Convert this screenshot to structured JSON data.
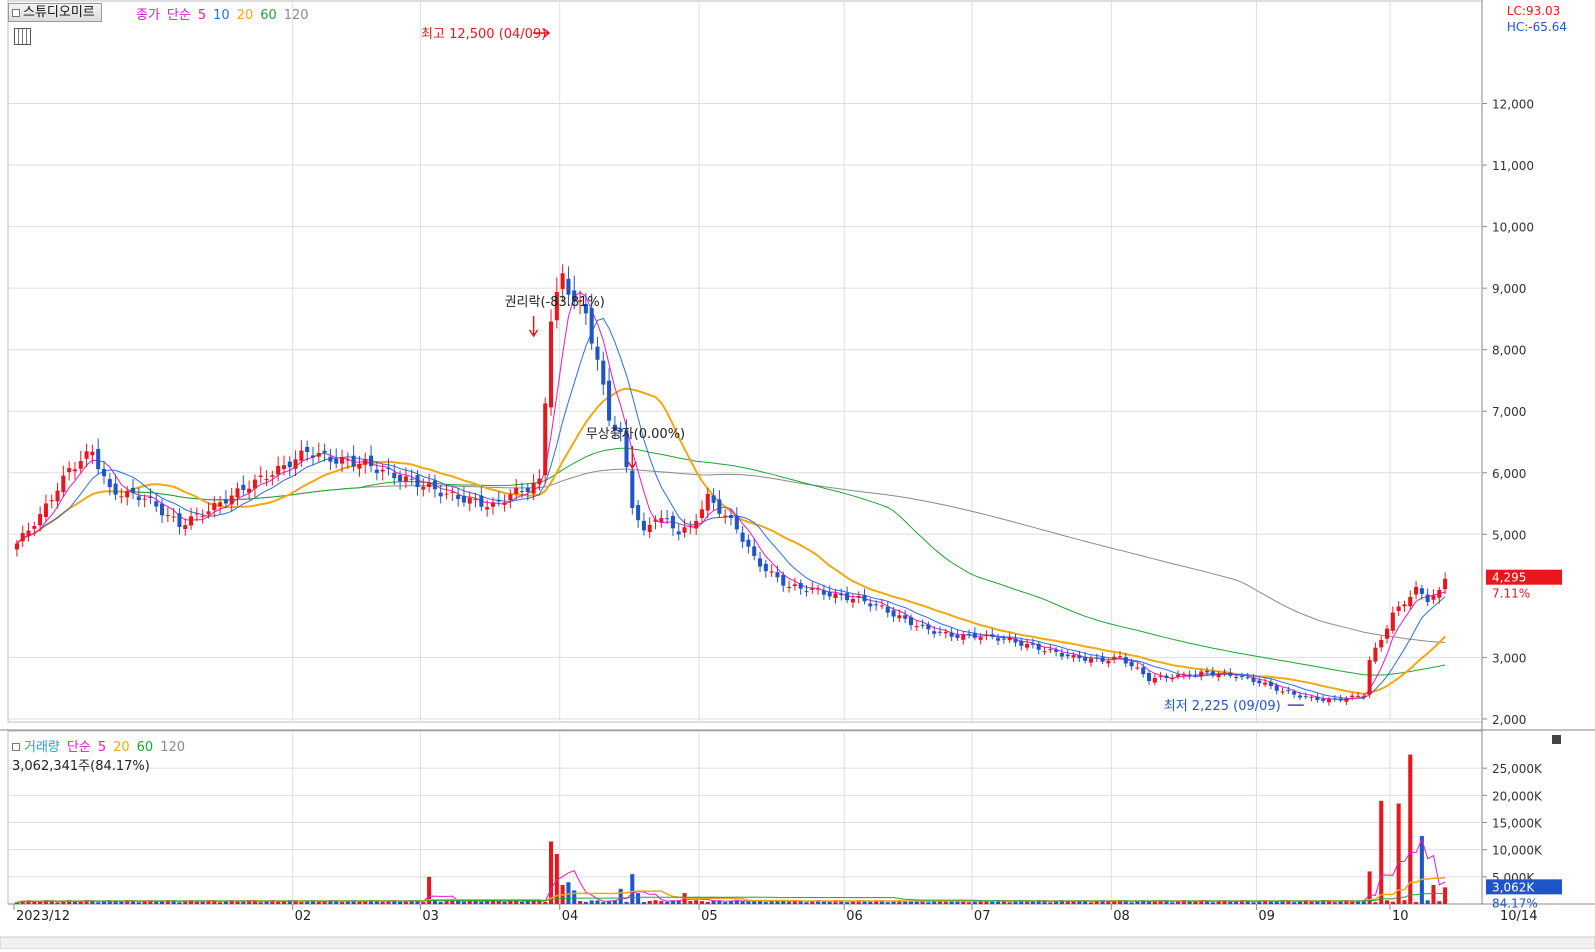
{
  "stock_name": "스튜디오미르",
  "price_legend": {
    "label": "종가",
    "method": "단순",
    "periods": [
      "5",
      "10",
      "20",
      "60",
      "120"
    ]
  },
  "volume_legend": {
    "label": "거래량",
    "method": "단순",
    "periods": [
      "5",
      "20",
      "60",
      "120"
    ]
  },
  "lc_text": "LC:93.03",
  "hc_text": "HC:-65.64",
  "volume_info": "3,062,341주(84.17%)",
  "last_price_label": "4,295",
  "last_change_label": "7.11%",
  "last_volume_label": "3,062K",
  "last_volume_pct_label": "84.17%",
  "annotations": {
    "high": "최고 12,500 (04/09)",
    "low": "최저 2,225 (09/09)",
    "rights": "권리락(-83.81%)",
    "bonus": "무상증자(0.00%)"
  },
  "x_labels": [
    "2023/12",
    "02",
    "03",
    "04",
    "05",
    "06",
    "07",
    "08",
    "09",
    "10",
    "10/14"
  ],
  "price_y_labels": [
    "12,000",
    "11,000",
    "10,000",
    "9,000",
    "8,000",
    "7,000",
    "6,000",
    "5,000",
    "3,000",
    "2,000"
  ],
  "volume_y_labels": [
    "25,000K",
    "20,000K",
    "15,000K",
    "10,000K",
    "5,000K"
  ],
  "colors": {
    "up": "#e8171e",
    "down": "#1f55c8",
    "ma5": "#e818c8",
    "ma10": "#2b6fe0",
    "ma20": "#f0a814",
    "ma60": "#21a336",
    "ma120": "#8a8a8a",
    "grid": "#dedede"
  },
  "chart_data": {
    "type": "candlestick",
    "price_ylim": [
      1950,
      13000
    ],
    "volume_ylim": [
      0,
      30000
    ],
    "date_range": [
      "2023-12-01",
      "2024-10-14"
    ],
    "month_boundaries": [
      {
        "label": "2023/12",
        "date": "2023-12-01"
      },
      {
        "label": "02",
        "date": "2024-02-01"
      },
      {
        "label": "03",
        "date": "2024-03-01"
      },
      {
        "label": "04",
        "date": "2024-04-01"
      },
      {
        "label": "05",
        "date": "2024-05-02"
      },
      {
        "label": "06",
        "date": "2024-06-03"
      },
      {
        "label": "07",
        "date": "2024-07-01"
      },
      {
        "label": "08",
        "date": "2024-08-01"
      },
      {
        "label": "09",
        "date": "2024-09-02"
      },
      {
        "label": "10",
        "date": "2024-10-02"
      }
    ],
    "close_waypoints": [
      [
        0,
        4850
      ],
      [
        4,
        5300
      ],
      [
        9,
        6050
      ],
      [
        13,
        6350
      ],
      [
        16,
        5700
      ],
      [
        22,
        5600
      ],
      [
        28,
        5150
      ],
      [
        34,
        5450
      ],
      [
        40,
        5800
      ],
      [
        46,
        6100
      ],
      [
        50,
        6350
      ],
      [
        55,
        6200
      ],
      [
        60,
        6150
      ],
      [
        65,
        5950
      ],
      [
        70,
        5800
      ],
      [
        74,
        5650
      ],
      [
        78,
        5550
      ],
      [
        82,
        5450
      ],
      [
        85,
        5650
      ],
      [
        88,
        5750
      ],
      [
        90,
        5850
      ],
      [
        92,
        8500
      ],
      [
        94,
        9200
      ],
      [
        96,
        8800
      ],
      [
        98,
        8600
      ],
      [
        100,
        7800
      ],
      [
        102,
        6900
      ],
      [
        104,
        6600
      ],
      [
        106,
        5500
      ],
      [
        108,
        5000
      ],
      [
        110,
        5300
      ],
      [
        112,
        5200
      ],
      [
        114,
        5050
      ],
      [
        116,
        5100
      ],
      [
        119,
        5600
      ],
      [
        121,
        5400
      ],
      [
        124,
        5100
      ],
      [
        127,
        4600
      ],
      [
        130,
        4350
      ],
      [
        133,
        4150
      ],
      [
        137,
        4100
      ],
      [
        141,
        4000
      ],
      [
        145,
        3950
      ],
      [
        149,
        3800
      ],
      [
        153,
        3600
      ],
      [
        157,
        3450
      ],
      [
        161,
        3350
      ],
      [
        166,
        3350
      ],
      [
        170,
        3300
      ],
      [
        174,
        3200
      ],
      [
        178,
        3100
      ],
      [
        182,
        3000
      ],
      [
        187,
        2950
      ],
      [
        190,
        3000
      ],
      [
        193,
        2800
      ],
      [
        195,
        2650
      ],
      [
        200,
        2700
      ],
      [
        205,
        2750
      ],
      [
        210,
        2700
      ],
      [
        214,
        2600
      ],
      [
        218,
        2450
      ],
      [
        222,
        2350
      ],
      [
        226,
        2300
      ],
      [
        230,
        2350
      ],
      [
        232,
        2400
      ],
      [
        233,
        2950
      ],
      [
        235,
        3300
      ],
      [
        237,
        3700
      ],
      [
        239,
        3900
      ],
      [
        241,
        4100
      ],
      [
        243,
        3950
      ],
      [
        245,
        4050
      ],
      [
        246,
        4295
      ]
    ],
    "volume_spikes": [
      {
        "i": 71,
        "v": 5000
      },
      {
        "i": 92,
        "v": 11500
      },
      {
        "i": 93,
        "v": 9200
      },
      {
        "i": 94,
        "v": 3500
      },
      {
        "i": 95,
        "v": 4000
      },
      {
        "i": 96,
        "v": 2500
      },
      {
        "i": 104,
        "v": 2800
      },
      {
        "i": 106,
        "v": 5500
      },
      {
        "i": 107,
        "v": 2000
      },
      {
        "i": 115,
        "v": 2000
      },
      {
        "i": 233,
        "v": 6000
      },
      {
        "i": 235,
        "v": 19000
      },
      {
        "i": 238,
        "v": 18500
      },
      {
        "i": 240,
        "v": 27500
      },
      {
        "i": 242,
        "v": 12500
      },
      {
        "i": 244,
        "v": 3500
      },
      {
        "i": 246,
        "v": 3062
      }
    ],
    "high": {
      "value": 12500,
      "date": "04/09"
    },
    "low": {
      "value": 2225,
      "date": "09/09"
    },
    "last": {
      "close": 4295,
      "change_pct": 7.11,
      "volume": 3062341,
      "volume_pct": 84.17
    }
  }
}
